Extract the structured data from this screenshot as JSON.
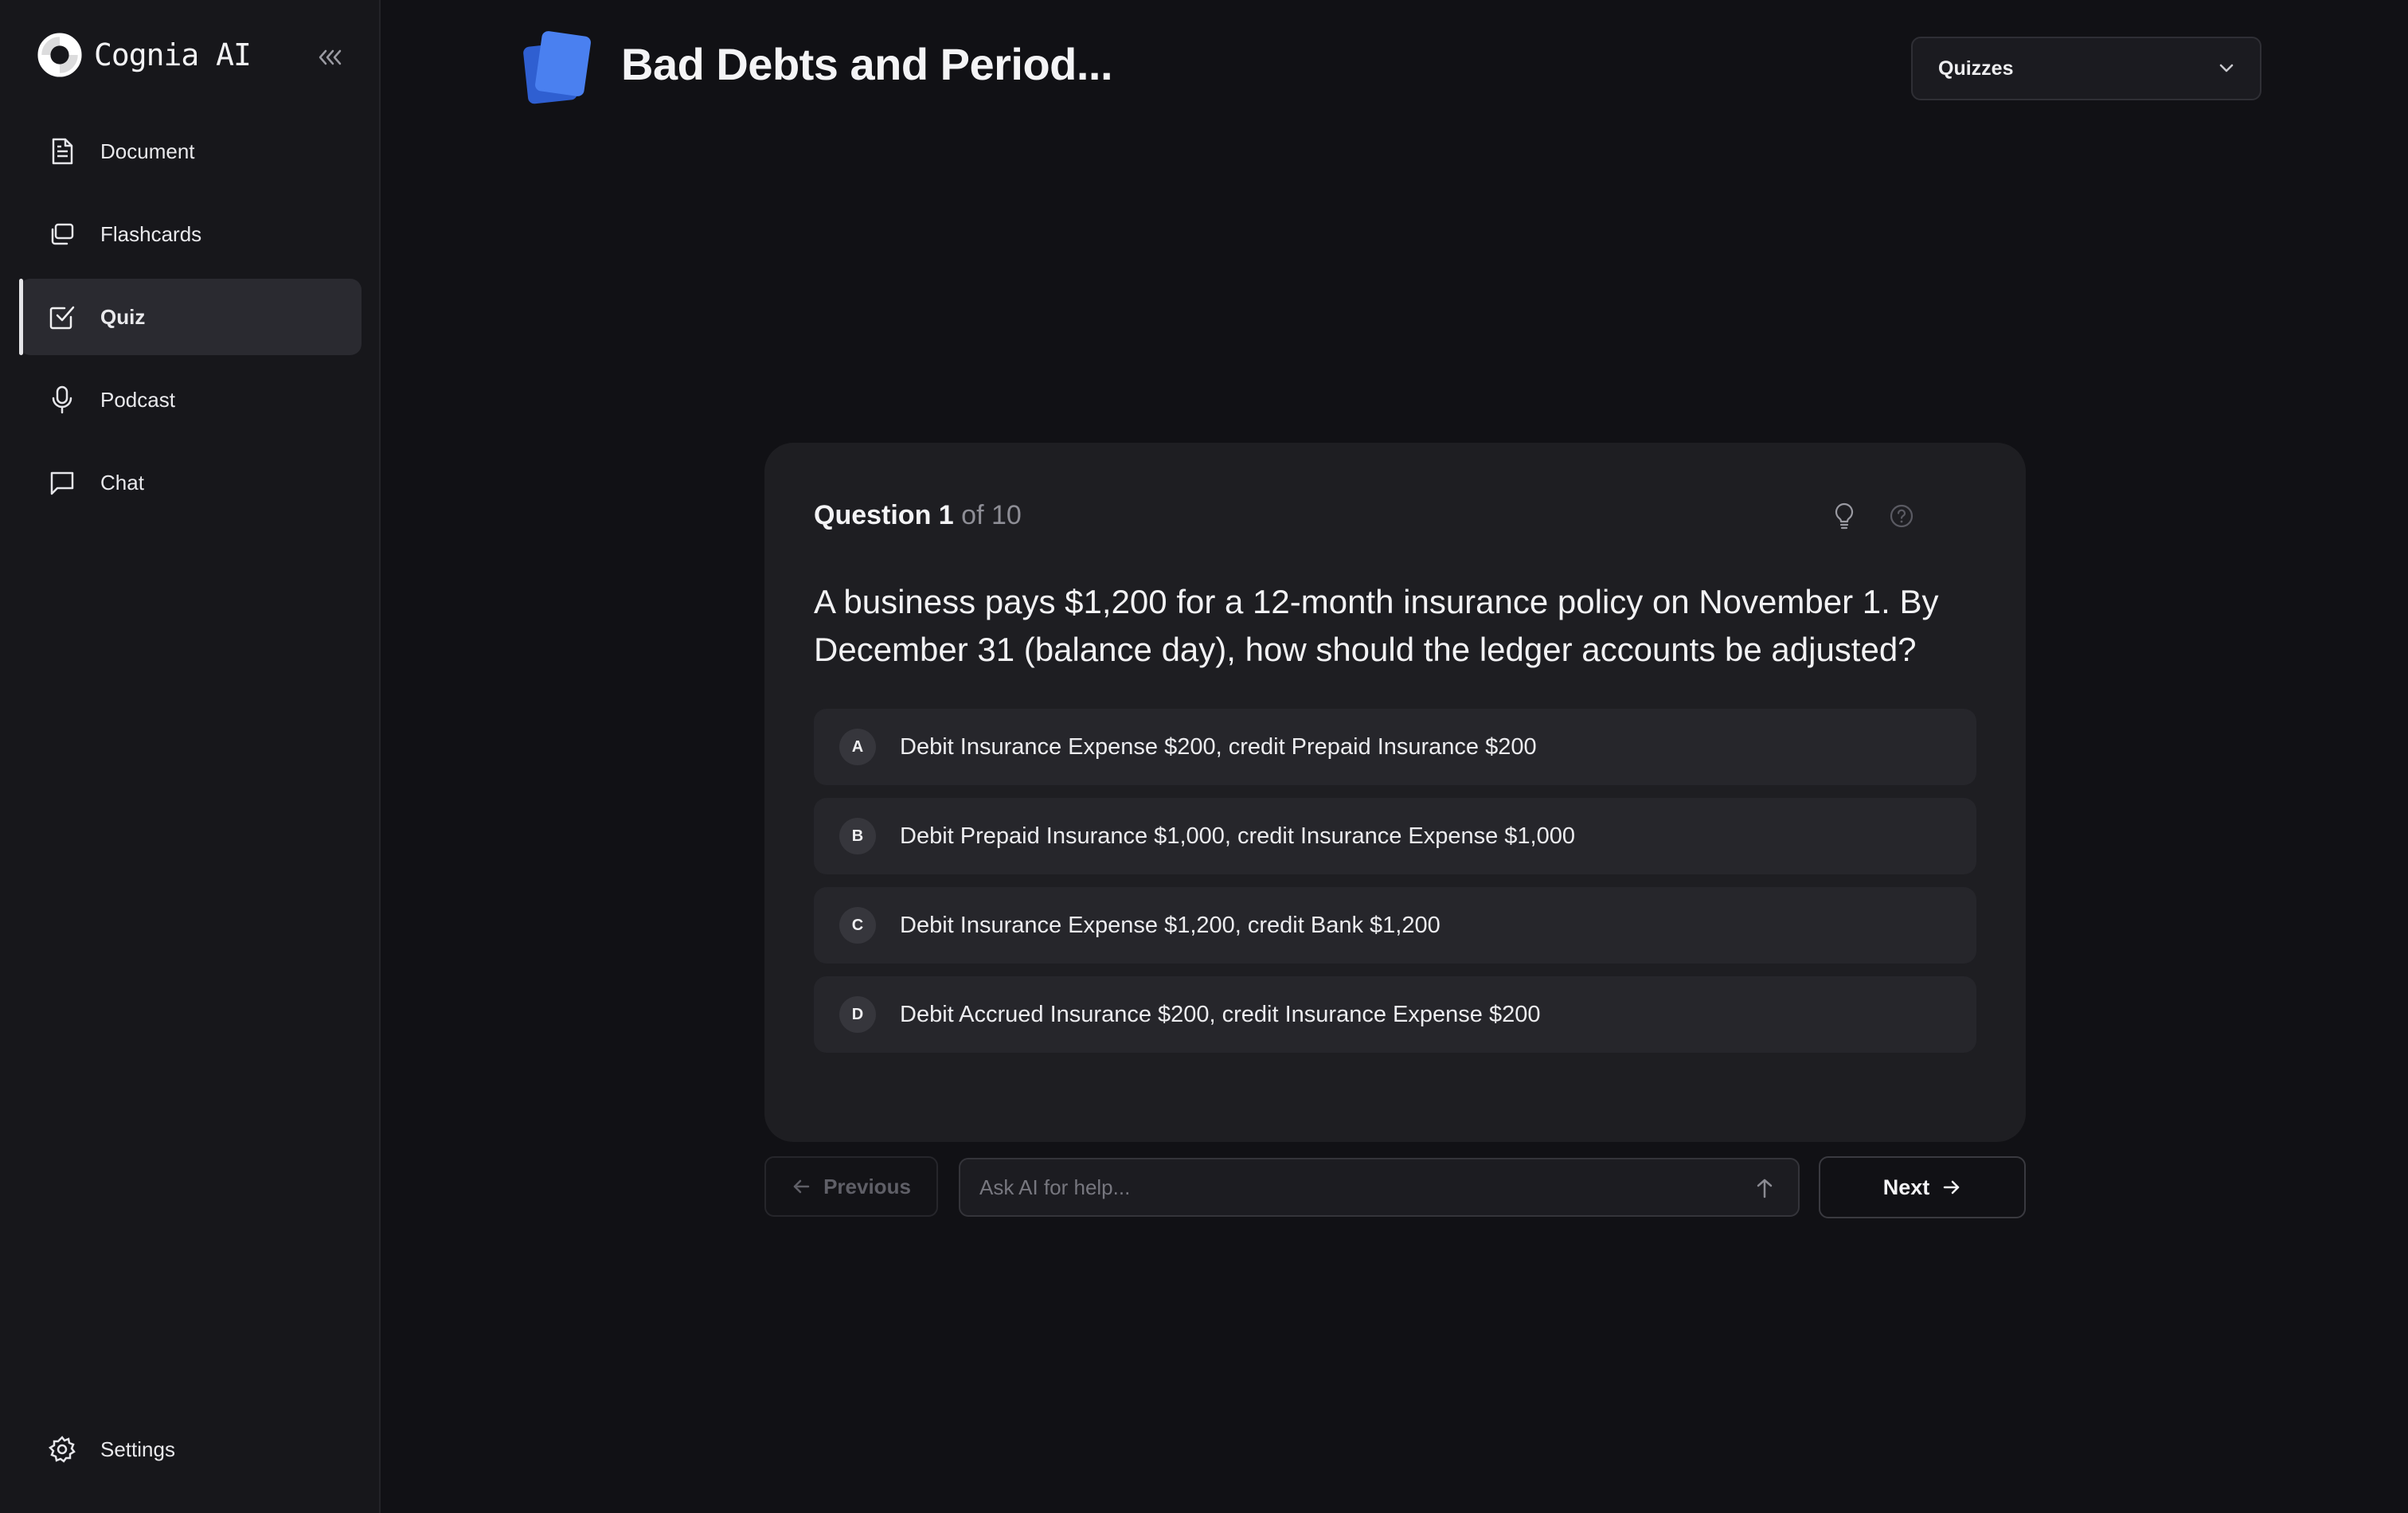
{
  "app": {
    "name": "Cognia AI"
  },
  "sidebar": {
    "items": [
      {
        "label": "Document",
        "icon": "document-icon"
      },
      {
        "label": "Flashcards",
        "icon": "flashcards-icon"
      },
      {
        "label": "Quiz",
        "icon": "quiz-check-icon",
        "active": true
      },
      {
        "label": "Podcast",
        "icon": "microphone-icon"
      },
      {
        "label": "Chat",
        "icon": "chat-bubble-icon"
      }
    ],
    "settings_label": "Settings"
  },
  "header": {
    "title": "Bad Debts and Period...",
    "dropdown_value": "Quizzes"
  },
  "quiz": {
    "question_label": "Question 1",
    "question_total": "of 10",
    "question_text": "A business pays $1,200 for a 12-month insurance policy on November 1. By December 31 (balance day), how should the ledger accounts be adjusted?",
    "options": [
      {
        "letter": "A",
        "text": "Debit Insurance Expense $200, credit Prepaid Insurance $200"
      },
      {
        "letter": "B",
        "text": "Debit Prepaid Insurance $1,000, credit Insurance Expense $1,000"
      },
      {
        "letter": "C",
        "text": "Debit Insurance Expense $1,200, credit Bank $1,200"
      },
      {
        "letter": "D",
        "text": "Debit Accrued Insurance $200, credit Insurance Expense $200"
      }
    ]
  },
  "controls": {
    "previous_label": "Previous",
    "ask_placeholder": "Ask AI for help...",
    "next_label": "Next"
  },
  "colors": {
    "background": "#111115",
    "sidebar": "#17171b",
    "card": "#1e1e22",
    "accent_blue": "#3b6fe0"
  }
}
